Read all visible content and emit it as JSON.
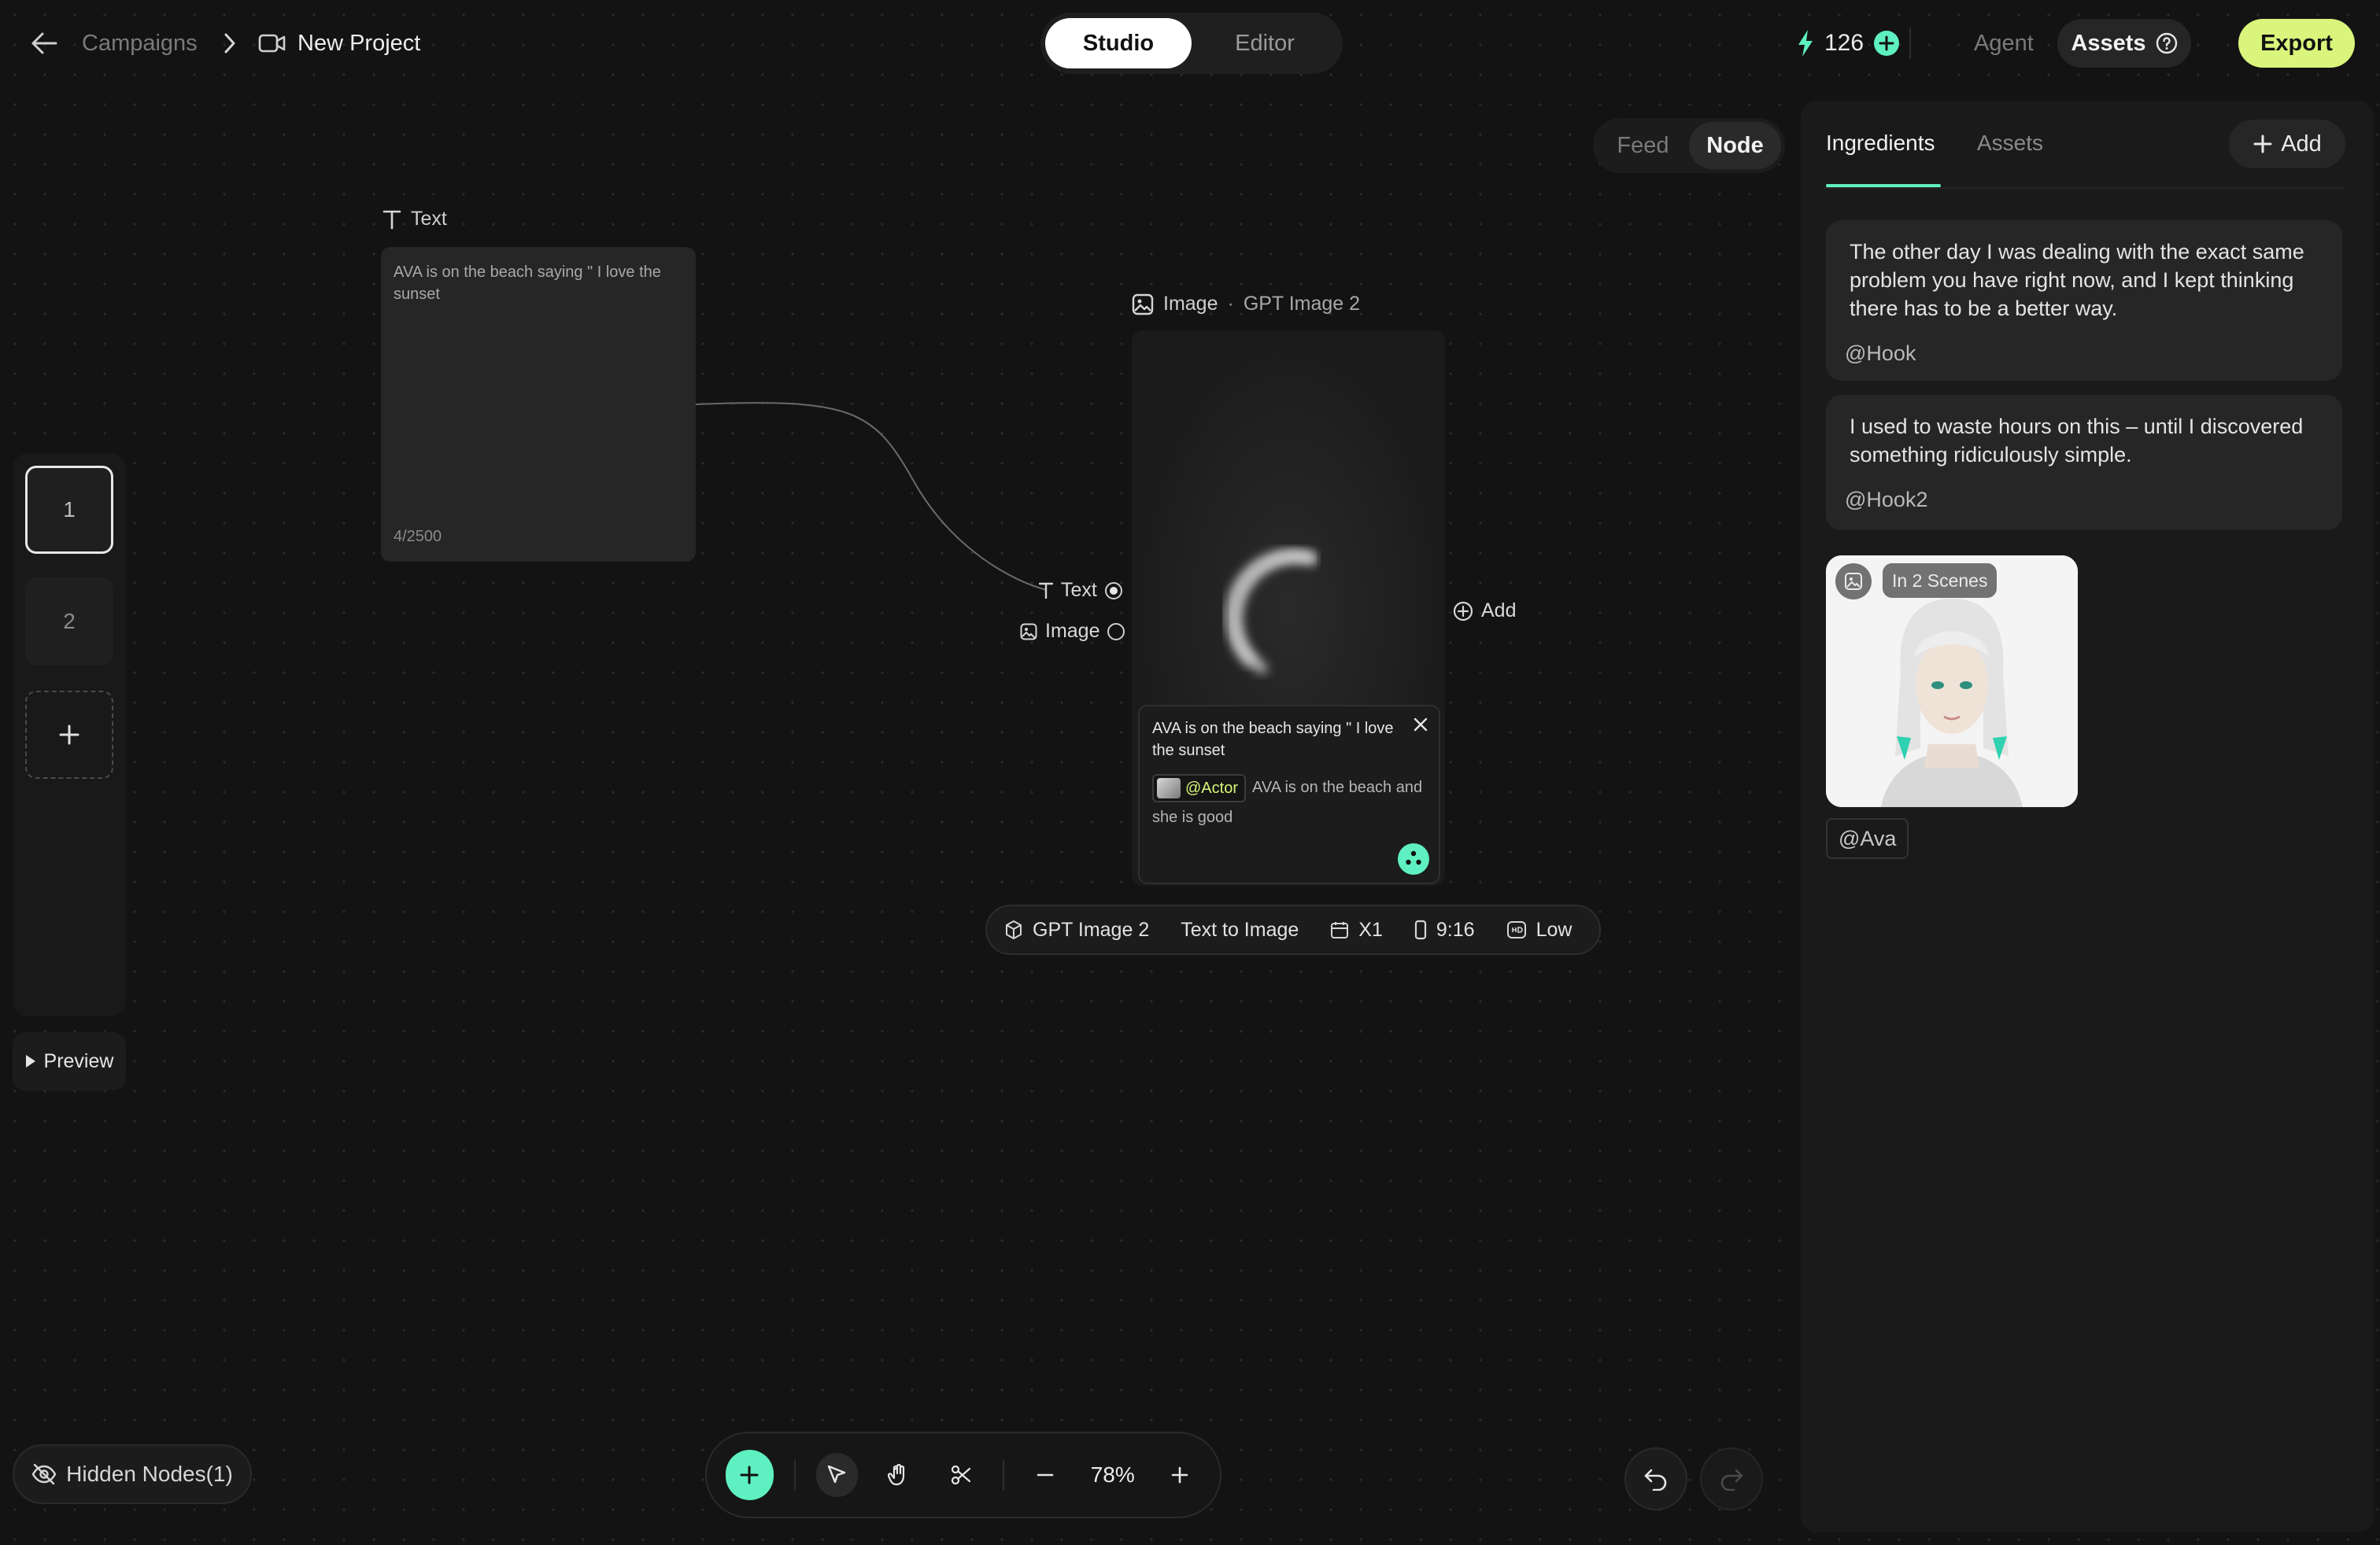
{
  "breadcrumb": {
    "parent": "Campaigns",
    "project": "New Project"
  },
  "mode_toggle": {
    "studio": "Studio",
    "editor": "Editor",
    "active": "Studio"
  },
  "credits": {
    "count": "126"
  },
  "header": {
    "agent": "Agent",
    "assets": "Assets",
    "export": "Export"
  },
  "view_toggle": {
    "feed": "Feed",
    "node": "Node",
    "active": "Node"
  },
  "scenes": {
    "items": [
      "1",
      "2"
    ],
    "active": "1",
    "preview": "Preview"
  },
  "text_node": {
    "label": "Text",
    "content": "AVA is on the beach saying \" I love the sunset",
    "counter": "4/2500"
  },
  "image_node": {
    "label": "Image",
    "model": "GPT Image 2",
    "inputs": {
      "text": "Text",
      "image": "Image"
    },
    "add": "Add",
    "prompt": {
      "quoted": "AVA is on the beach saying \" I love the sunset",
      "actor": "@Actor",
      "text": "AVA is on the beach and she is good"
    },
    "toolbar": {
      "model": "GPT Image 2",
      "mode": "Text to Image",
      "count": "X1",
      "ratio": "9:16",
      "quality": "Low"
    }
  },
  "panel": {
    "tabs": [
      "Ingredients",
      "Assets"
    ],
    "active_tab": "Ingredients",
    "add": "Add",
    "cards": [
      {
        "text": "The other day I was dealing with the exact same problem you have right now, and I kept thinking there has to be a better way.",
        "tag": "@Hook"
      },
      {
        "text": "I used to waste hours on this – until I discovered something ridiculously simple.",
        "tag": "@Hook2"
      }
    ],
    "asset": {
      "badge": "In 2 Scenes",
      "tag": "@Ava"
    }
  },
  "footer": {
    "hidden_nodes": "Hidden Nodes(1)",
    "zoom": "78%"
  },
  "colors": {
    "accent": "#5ff0c1",
    "export": "#d9f57c",
    "background": "#131313"
  },
  "icons": [
    "back-arrow-icon",
    "chevron-right-icon",
    "video-camera-icon",
    "lightning-icon",
    "plus-circle-icon",
    "help-icon",
    "text-type-icon",
    "image-icon",
    "play-icon",
    "eye-off-icon",
    "cursor-icon",
    "hand-icon",
    "scissors-icon",
    "minus-icon",
    "plus-icon",
    "undo-icon",
    "redo-icon",
    "cube-icon",
    "calendar-icon",
    "phone-ratio-icon",
    "hd-icon",
    "close-icon",
    "sparkle-icon"
  ]
}
